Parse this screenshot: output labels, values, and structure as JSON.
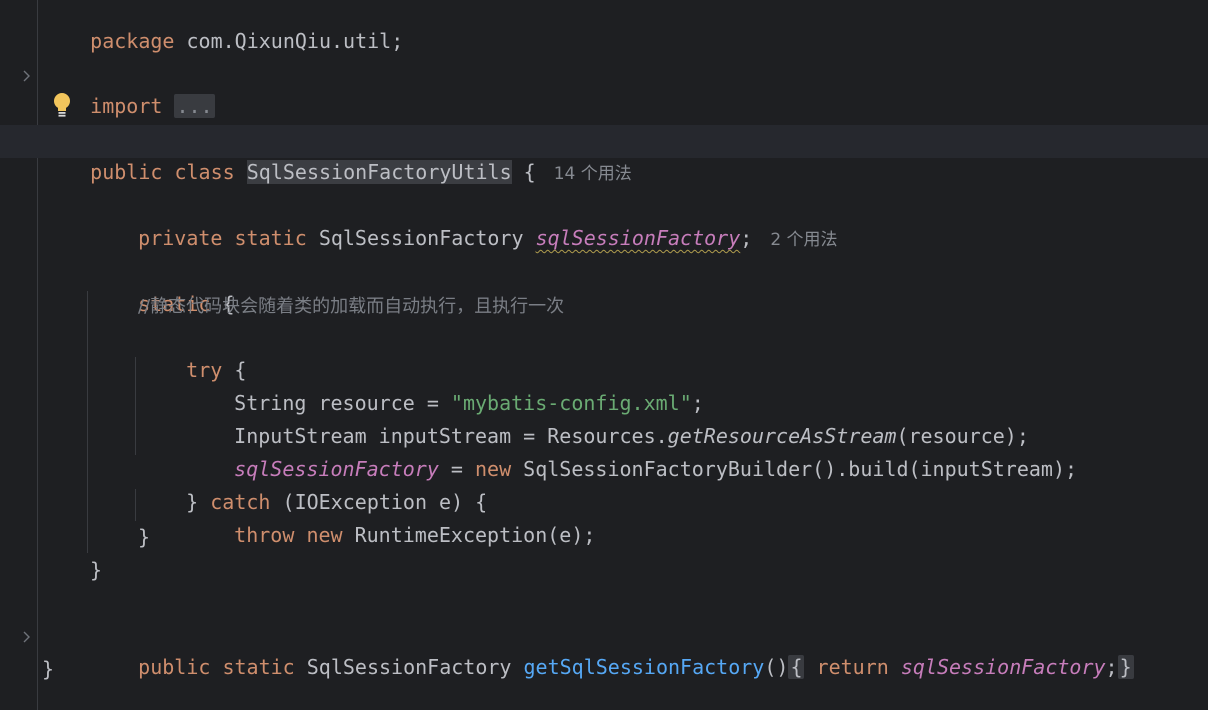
{
  "editor": {
    "lines": {
      "package": {
        "kw": "package",
        "rest": " com.QixunQiu.util;"
      },
      "import": {
        "kw": "import",
        "fold": "..."
      },
      "class_decl": {
        "public": "public",
        "class": "class",
        "name": "SqlSessionFactoryUtils",
        "brace": " {",
        "hint": "14 个用法"
      },
      "field_decl": {
        "private": "private",
        "static": "static",
        "type": "SqlSessionFactory",
        "field": "sqlSessionFactory",
        "semi": ";",
        "hint": "2 个用法"
      },
      "static_block": {
        "kw": "static",
        "brace": " {"
      },
      "comment": "//静态代码块会随着类的加载而自动执行，且执行一次",
      "try": {
        "kw": "try",
        "brace": " {"
      },
      "resource": {
        "pre": "String resource = ",
        "str": "\"mybatis-config.xml\"",
        "semi": ";"
      },
      "input_stream": {
        "pre": "InputStream inputStream = Resources.",
        "method": "getResourceAsStream",
        "post": "(resource);"
      },
      "assign": {
        "field": "sqlSessionFactory",
        "eq": " = ",
        "new": "new",
        "post": " SqlSessionFactoryBuilder().build(inputStream);"
      },
      "catch": {
        "close": "} ",
        "kw": "catch",
        "post": " (IOException e) {"
      },
      "throw": {
        "throw": "throw",
        "new": "new",
        "post": " RuntimeException(e);"
      },
      "close_try": "}",
      "close_static": "}",
      "getter": {
        "public": "public",
        "static": "static",
        "type": "SqlSessionFactory",
        "method": "getSqlSessionFactory",
        "parens": "()",
        "open": "{",
        "return": "return",
        "field": "sqlSessionFactory",
        "semi": ";",
        "close": "}"
      },
      "close_class": "}"
    },
    "colors": {
      "background": "#1e1f22",
      "keyword": "#cf8e6d",
      "field": "#c77dbb",
      "string": "#6aab73",
      "method": "#56a8f5",
      "comment": "#7a7e85",
      "text": "#bcbec4",
      "bulb": "#f2c55c"
    },
    "icons": [
      "fold-arrow-icon",
      "lightbulb-icon"
    ]
  }
}
